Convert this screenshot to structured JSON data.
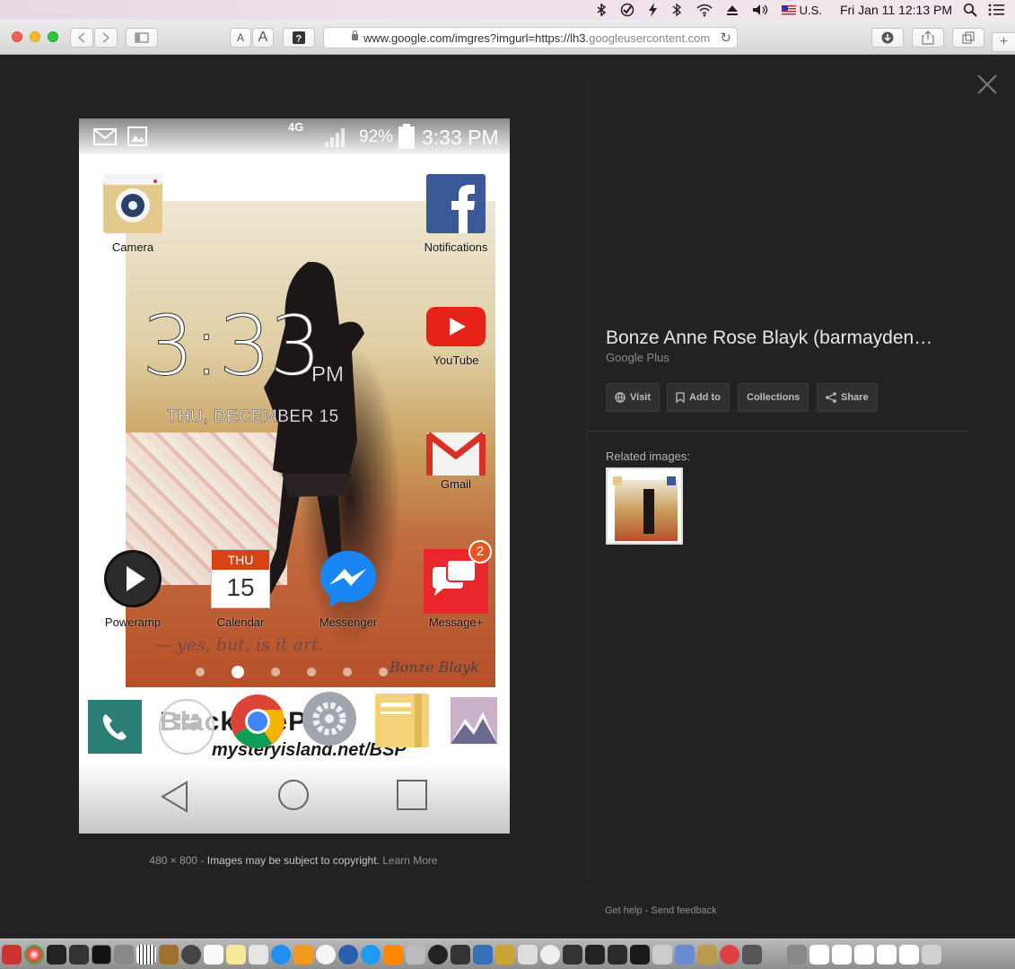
{
  "menubar": {
    "input_source": "U.S.",
    "clock": "Fri Jan 11  12:13 PM"
  },
  "toolbar": {
    "url_main": "www.google.com/imgres?imgurl=https://lh3.",
    "url_rest": "googleusercontent.com",
    "font_small": "A",
    "font_large": "A"
  },
  "phone": {
    "status": {
      "network": "4G",
      "battery": "92%",
      "time": "3:33 PM"
    },
    "apps": {
      "camera": "Camera",
      "notifications": "Notifications",
      "youtube": "YouTube",
      "gmail": "Gmail",
      "poweramp": "Poweramp",
      "calendar": "Calendar",
      "calendar_day": "THU",
      "calendar_date": "15",
      "messenger": "Messenger",
      "messageplus": "Message+",
      "message_badge": "2"
    },
    "clock": {
      "time": "3:33",
      "ampm": "PM",
      "date": "THU, DECEMBER 15"
    },
    "tagline": "— yes, but, is it art.",
    "signature": "Bonze Blayk",
    "watermark": "BlackSheP",
    "watermark_url": "mysteryisland.net/BSP",
    "page_dots": 6,
    "active_dot": 1
  },
  "caption": {
    "dimensions": "480 × 800",
    "sep": " - ",
    "notice": "Images may be subject to copyright.",
    "learn_more": "Learn More"
  },
  "panel": {
    "title": "Bonze Anne Rose Blayk (barmayden…",
    "source": "Google Plus",
    "actions": {
      "visit": "Visit",
      "add_to": "Add to",
      "collections": "Collections",
      "share": "Share"
    },
    "related_label": "Related images:"
  },
  "footer": {
    "help": "Get help",
    "sep": " - ",
    "feedback": "Send feedback"
  },
  "colors": {
    "viewer_bg": "#222222",
    "youtube_red": "#e62117",
    "facebook_blue": "#3b5998",
    "badge_orange": "#e8551f"
  }
}
